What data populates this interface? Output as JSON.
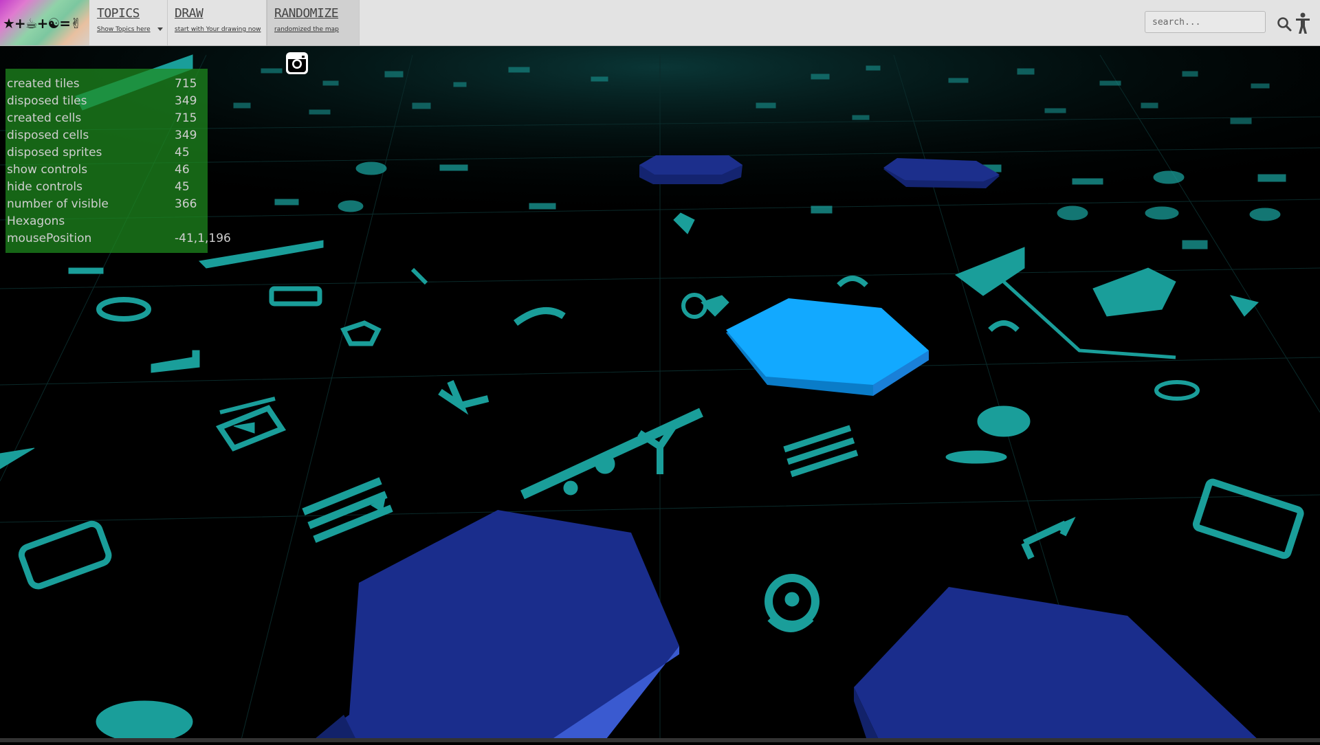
{
  "app": {
    "logo_text": "★+☕+☯=✌",
    "colors": {
      "topbar_bg": "#e3e3e3",
      "scene_bg": "#000000",
      "icon_teal": "#1a9e9a",
      "hex_dark": "#1b2e8c",
      "hex_bright": "#10a8ff",
      "stats_bg": "#1e8c1e"
    }
  },
  "nav": {
    "items": [
      {
        "title": "TOPICS",
        "subtitle": "Show Topics here",
        "has_dropdown": true
      },
      {
        "title": "DRAW",
        "subtitle": "start with Your drawing now",
        "has_dropdown": false
      },
      {
        "title": "RANDOMIZE",
        "subtitle": "randomized the map",
        "has_dropdown": false
      }
    ]
  },
  "search": {
    "placeholder": "search..."
  },
  "icons": {
    "search": "search-icon",
    "accessibility": "accessibility-icon",
    "instagram": "instagram-icon"
  },
  "stats": {
    "rows": [
      {
        "label": "created tiles",
        "value": "715"
      },
      {
        "label": "disposed tiles",
        "value": "349"
      },
      {
        "label": "created cells",
        "value": "715"
      },
      {
        "label": "disposed cells",
        "value": "349"
      },
      {
        "label": "disposed sprites",
        "value": "45"
      },
      {
        "label": "show controls",
        "value": "46"
      },
      {
        "label": "hide controls",
        "value": "45"
      },
      {
        "label": "number of visible",
        "value": "366"
      },
      {
        "label": "Hexagons",
        "value": ""
      },
      {
        "label": "mousePosition",
        "value": "-41,1,196"
      }
    ]
  }
}
